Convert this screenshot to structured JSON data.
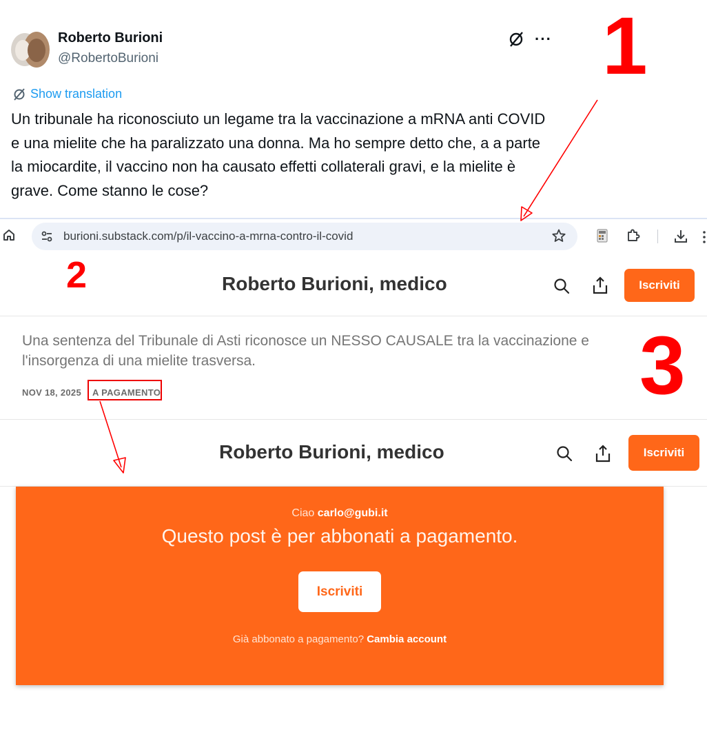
{
  "tweet": {
    "name": "Roberto Burioni",
    "handle": "@RobertoBurioni",
    "more": "···",
    "translation": "Show translation",
    "text": "Un tribunale ha riconosciuto un legame tra la vaccinazione a mRNA anti COVID e una mielite che ha paralizzato una donna. Ma  ho sempre detto che, a a parte la miocardite, il vaccino non ha causato effetti collaterali gravi, e la mielite è grave.  Come stanno le cose?"
  },
  "browser": {
    "url": "burioni.substack.com/p/il-vaccino-a-mrna-contro-il-covid",
    "icons": [
      "home-icon",
      "site-settings-icon",
      "star-icon",
      "extension-icon",
      "puzzle-icon",
      "download-icon",
      "more-icon"
    ]
  },
  "header1": {
    "title": "Roberto Burioni, medico",
    "subscribe": "Iscriviti"
  },
  "post": {
    "subtitle": "Una sentenza del Tribunale di Asti riconosce un NESSO CAUSALE tra la vaccinazione e l'insorgenza di una mielite trasversa.",
    "date": "NOV 18, 2025",
    "access": "A PAGAMENTO"
  },
  "header2": {
    "title": "Roberto Burioni, medico",
    "subscribe": "Iscriviti"
  },
  "paywall": {
    "greeting": "Ciao",
    "email": "carlo@gubi.it",
    "title": "Questo post è per abbonati a pagamento.",
    "button": "Iscriviti",
    "already": "Già abbonato a pagamento?",
    "switch": "Cambia account"
  },
  "annotations": {
    "n1": "1",
    "n2": "2",
    "n3": "3",
    "color": "#ff0000"
  },
  "colors": {
    "accent": "#ff6719",
    "link": "#1d9bf0"
  }
}
